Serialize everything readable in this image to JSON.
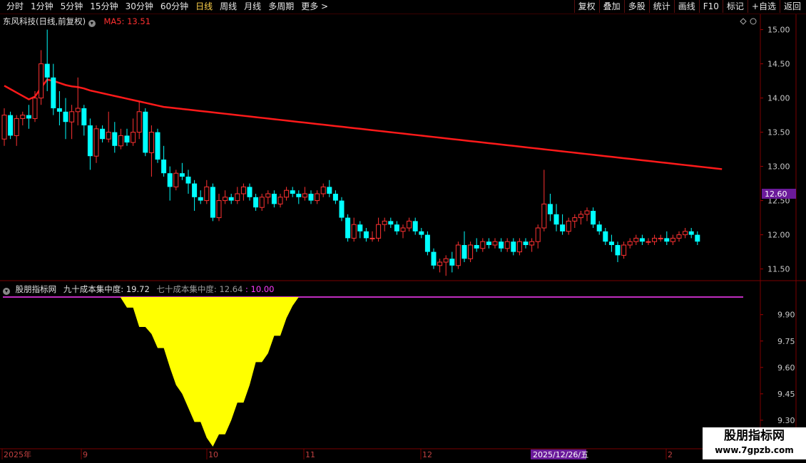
{
  "toolbar": {
    "periods": [
      "分时",
      "1分钟",
      "5分钟",
      "15分钟",
      "30分钟",
      "60分钟",
      "日线",
      "周线",
      "月线",
      "多周期",
      "更多 >"
    ],
    "active_period": "日线",
    "actions": [
      "复权",
      "叠加",
      "多股",
      "统计",
      "画线",
      "F10",
      "标记",
      "+自选",
      "返回"
    ]
  },
  "main_header": {
    "stock": "东风科技(日线,前复权)",
    "ma_label": "MA5: 13.51",
    "ma_color": "#ff2020"
  },
  "price_axis": {
    "ticks": [
      "15.00",
      "14.50",
      "14.00",
      "13.50",
      "13.00",
      "12.50",
      "12.00",
      "11.50"
    ],
    "tick_values": [
      15.0,
      14.5,
      14.0,
      13.5,
      13.0,
      12.5,
      12.0,
      11.5
    ],
    "current_price": "12.60",
    "current_value": 12.6
  },
  "indicator_header": {
    "name": "股朋指标网",
    "label90": "九十成本集中度: 19.72",
    "label70": "七十成本集中度: 12.64",
    "label10": ": 10.00"
  },
  "indicator_axis": {
    "ticks": [
      "9.90",
      "9.75",
      "9.60",
      "9.45",
      "9.30"
    ],
    "tick_values": [
      9.9,
      9.75,
      9.6,
      9.45,
      9.3
    ]
  },
  "date_axis": {
    "labels": [
      "2025年",
      "9",
      "10",
      "11",
      "12",
      "2",
      "2025/12/26/五"
    ],
    "highlight": "2025/12/26/五"
  },
  "watermark": {
    "line1": "股朋指标网",
    "line2": "www.7gpzb.com"
  },
  "colors": {
    "up": "#ff3232",
    "down": "#00ffff",
    "ma": "#ff1a1a",
    "area": "#ffff00",
    "line10": "#ff3cff",
    "highlight_bg": "#6a1a9a"
  },
  "chart_data": [
    {
      "type": "candlestick",
      "title": "东风科技(日线,前复权)",
      "ylim": [
        11.35,
        15.1
      ],
      "candles": [
        [
          13.4,
          13.85,
          13.3,
          13.75
        ],
        [
          13.75,
          13.8,
          13.4,
          13.45
        ],
        [
          13.45,
          13.75,
          13.3,
          13.7
        ],
        [
          13.7,
          13.8,
          13.6,
          13.75
        ],
        [
          13.75,
          13.9,
          13.55,
          13.7
        ],
        [
          13.7,
          14.1,
          13.65,
          14.0
        ],
        [
          14.0,
          14.7,
          13.9,
          14.5
        ],
        [
          14.5,
          15.0,
          14.1,
          14.3
        ],
        [
          14.3,
          14.5,
          13.75,
          13.85
        ],
        [
          13.85,
          14.1,
          13.6,
          13.8
        ],
        [
          13.8,
          14.0,
          13.4,
          13.65
        ],
        [
          13.65,
          13.9,
          13.4,
          13.8
        ],
        [
          13.8,
          14.3,
          13.6,
          13.85
        ],
        [
          13.85,
          13.9,
          13.45,
          13.6
        ],
        [
          13.6,
          13.7,
          12.95,
          13.15
        ],
        [
          13.15,
          13.6,
          13.05,
          13.55
        ],
        [
          13.55,
          13.6,
          13.35,
          13.4
        ],
        [
          13.4,
          13.8,
          13.35,
          13.5
        ],
        [
          13.5,
          13.65,
          13.2,
          13.3
        ],
        [
          13.3,
          13.55,
          13.25,
          13.45
        ],
        [
          13.45,
          13.55,
          13.3,
          13.35
        ],
        [
          13.35,
          13.7,
          13.3,
          13.5
        ],
        [
          13.5,
          13.95,
          13.4,
          13.8
        ],
        [
          13.8,
          13.85,
          13.15,
          13.2
        ],
        [
          13.2,
          13.6,
          12.85,
          13.5
        ],
        [
          13.5,
          13.55,
          13.05,
          13.1
        ],
        [
          13.1,
          13.3,
          12.85,
          12.9
        ],
        [
          12.9,
          13.0,
          12.5,
          12.7
        ],
        [
          12.7,
          12.95,
          12.65,
          12.9
        ],
        [
          12.9,
          13.05,
          12.8,
          12.85
        ],
        [
          12.85,
          12.95,
          12.6,
          12.75
        ],
        [
          12.75,
          12.8,
          12.35,
          12.55
        ],
        [
          12.55,
          12.65,
          12.45,
          12.5
        ],
        [
          12.5,
          12.8,
          12.45,
          12.7
        ],
        [
          12.7,
          12.75,
          12.2,
          12.25
        ],
        [
          12.25,
          12.6,
          12.2,
          12.5
        ],
        [
          12.5,
          12.65,
          12.45,
          12.55
        ],
        [
          12.55,
          12.6,
          12.45,
          12.5
        ],
        [
          12.5,
          12.7,
          12.45,
          12.6
        ],
        [
          12.6,
          12.75,
          12.5,
          12.7
        ],
        [
          12.7,
          12.75,
          12.5,
          12.55
        ],
        [
          12.55,
          12.6,
          12.35,
          12.4
        ],
        [
          12.4,
          12.6,
          12.35,
          12.55
        ],
        [
          12.55,
          12.65,
          12.45,
          12.6
        ],
        [
          12.6,
          12.65,
          12.4,
          12.45
        ],
        [
          12.45,
          12.6,
          12.4,
          12.55
        ],
        [
          12.55,
          12.7,
          12.5,
          12.65
        ],
        [
          12.65,
          12.7,
          12.55,
          12.6
        ],
        [
          12.6,
          12.65,
          12.45,
          12.55
        ],
        [
          12.55,
          12.7,
          12.5,
          12.6
        ],
        [
          12.6,
          12.65,
          12.45,
          12.5
        ],
        [
          12.5,
          12.65,
          12.45,
          12.6
        ],
        [
          12.6,
          12.75,
          12.55,
          12.7
        ],
        [
          12.7,
          12.8,
          12.55,
          12.6
        ],
        [
          12.6,
          12.65,
          12.45,
          12.5
        ],
        [
          12.5,
          12.55,
          12.2,
          12.25
        ],
        [
          12.25,
          12.3,
          11.9,
          11.95
        ],
        [
          11.95,
          12.25,
          11.9,
          12.15
        ],
        [
          12.15,
          12.2,
          11.95,
          12.05
        ],
        [
          12.05,
          12.1,
          11.9,
          11.95
        ],
        [
          11.95,
          12.05,
          11.9,
          11.95
        ],
        [
          11.95,
          12.25,
          11.9,
          12.15
        ],
        [
          12.15,
          12.25,
          12.05,
          12.2
        ],
        [
          12.2,
          12.25,
          12.1,
          12.15
        ],
        [
          12.15,
          12.2,
          12.0,
          12.05
        ],
        [
          12.05,
          12.15,
          11.95,
          12.1
        ],
        [
          12.1,
          12.25,
          12.05,
          12.2
        ],
        [
          12.2,
          12.25,
          12.0,
          12.05
        ],
        [
          12.05,
          12.1,
          11.95,
          12.0
        ],
        [
          12.0,
          12.05,
          11.7,
          11.75
        ],
        [
          11.75,
          11.8,
          11.5,
          11.55
        ],
        [
          11.55,
          11.65,
          11.45,
          11.6
        ],
        [
          11.6,
          11.7,
          11.4,
          11.65
        ],
        [
          11.65,
          11.75,
          11.45,
          11.55
        ],
        [
          11.55,
          11.9,
          11.5,
          11.85
        ],
        [
          11.85,
          12.05,
          11.6,
          11.65
        ],
        [
          11.65,
          11.9,
          11.6,
          11.85
        ],
        [
          11.85,
          11.95,
          11.75,
          11.8
        ],
        [
          11.8,
          11.95,
          11.75,
          11.9
        ],
        [
          11.9,
          11.95,
          11.8,
          11.85
        ],
        [
          11.85,
          11.95,
          11.8,
          11.9
        ],
        [
          11.9,
          11.95,
          11.75,
          11.8
        ],
        [
          11.8,
          11.95,
          11.75,
          11.9
        ],
        [
          11.9,
          11.95,
          11.7,
          11.75
        ],
        [
          11.75,
          11.95,
          11.7,
          11.9
        ],
        [
          11.9,
          11.95,
          11.8,
          11.85
        ],
        [
          11.85,
          11.95,
          11.75,
          11.9
        ],
        [
          11.9,
          12.15,
          11.8,
          12.1
        ],
        [
          12.1,
          12.95,
          12.05,
          12.45
        ],
        [
          12.45,
          12.6,
          12.2,
          12.3
        ],
        [
          12.3,
          12.45,
          12.05,
          12.15
        ],
        [
          12.15,
          12.3,
          12.0,
          12.05
        ],
        [
          12.05,
          12.25,
          12.0,
          12.2
        ],
        [
          12.2,
          12.3,
          12.1,
          12.25
        ],
        [
          12.25,
          12.35,
          12.15,
          12.3
        ],
        [
          12.3,
          12.4,
          12.2,
          12.35
        ],
        [
          12.35,
          12.4,
          12.1,
          12.15
        ],
        [
          12.15,
          12.2,
          12.0,
          12.05
        ],
        [
          12.05,
          12.1,
          11.85,
          11.9
        ],
        [
          11.9,
          12.0,
          11.75,
          11.85
        ],
        [
          11.85,
          11.9,
          11.6,
          11.7
        ],
        [
          11.7,
          11.9,
          11.65,
          11.85
        ],
        [
          11.85,
          11.95,
          11.8,
          11.9
        ],
        [
          11.9,
          12.0,
          11.85,
          11.95
        ],
        [
          11.95,
          12.0,
          11.85,
          11.9
        ],
        [
          11.9,
          11.95,
          11.85,
          11.9
        ],
        [
          11.9,
          12.0,
          11.85,
          11.95
        ],
        [
          11.95,
          12.0,
          11.9,
          11.95
        ],
        [
          11.95,
          12.05,
          11.85,
          11.9
        ],
        [
          11.9,
          12.0,
          11.85,
          11.95
        ],
        [
          11.95,
          12.05,
          11.9,
          12.0
        ],
        [
          12.0,
          12.1,
          11.95,
          12.05
        ],
        [
          12.05,
          12.1,
          11.95,
          12.0
        ],
        [
          12.0,
          12.05,
          11.85,
          11.9
        ]
      ],
      "ma": [
        14.18,
        14.13,
        14.08,
        14.03,
        13.98,
        14.02,
        14.15,
        14.27,
        14.25,
        14.22,
        14.19,
        14.17,
        14.16,
        14.14,
        14.11,
        14.09,
        14.07,
        14.05,
        14.03,
        14.01,
        13.99,
        13.97,
        13.95,
        13.93,
        13.91,
        13.89,
        13.87,
        13.86,
        13.85,
        13.84,
        13.83,
        13.82,
        13.81,
        13.8,
        13.79,
        13.78,
        13.77,
        13.76,
        13.75,
        13.74,
        13.73,
        13.72,
        13.71,
        13.7,
        13.69,
        13.68,
        13.67,
        13.66,
        13.65,
        13.64,
        13.63,
        13.62,
        13.61,
        13.6,
        13.59,
        13.58,
        13.57,
        13.56,
        13.55,
        13.54,
        13.53,
        13.52,
        13.51,
        13.5,
        13.49,
        13.48,
        13.47,
        13.46,
        13.45,
        13.44,
        13.43,
        13.42,
        13.41,
        13.4,
        13.39,
        13.38,
        13.37,
        13.36,
        13.35,
        13.34,
        13.33,
        13.32,
        13.31,
        13.3,
        13.29,
        13.28,
        13.27,
        13.26,
        13.25,
        13.24,
        13.23,
        13.22,
        13.21,
        13.2,
        13.19,
        13.18,
        13.17,
        13.16,
        13.15,
        13.14,
        13.13,
        13.12,
        13.11,
        13.1,
        13.09,
        13.08,
        13.07,
        13.06,
        13.05,
        13.04,
        13.03,
        13.02,
        13.01,
        13.0,
        12.99,
        12.98,
        12.97,
        12.96
      ]
    },
    {
      "type": "area",
      "ylim": [
        9.15,
        10.0
      ],
      "base": 10.0,
      "start_index": 19,
      "values": [
        9.995,
        9.94,
        9.94,
        9.83,
        9.83,
        9.79,
        9.71,
        9.71,
        9.6,
        9.5,
        9.45,
        9.37,
        9.29,
        9.29,
        9.2,
        9.15,
        9.22,
        9.22,
        9.3,
        9.4,
        9.4,
        9.5,
        9.63,
        9.63,
        9.68,
        9.78,
        9.78,
        9.88,
        9.95,
        10.0
      ],
      "line_value": 10.0
    }
  ]
}
